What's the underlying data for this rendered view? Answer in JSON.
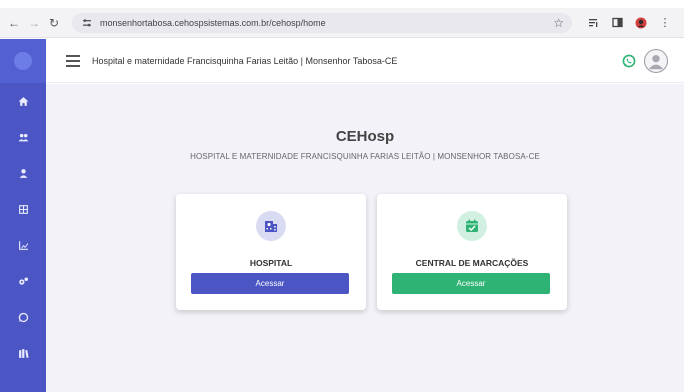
{
  "browser": {
    "url": "monsenhortabosa.cehospsistemas.com.br/cehosp/home"
  },
  "header": {
    "title": "Hospital e maternidade Francisquinha Farias Leitão | Monsenhor Tabosa-CE"
  },
  "sidebar": {
    "items": [
      {
        "icon": "home-icon"
      },
      {
        "icon": "users-icon"
      },
      {
        "icon": "user-icon"
      },
      {
        "icon": "grid-icon"
      },
      {
        "icon": "chart-icon"
      },
      {
        "icon": "cogs-icon"
      },
      {
        "icon": "whatsapp-icon"
      },
      {
        "icon": "library-icon"
      }
    ]
  },
  "main": {
    "title": "CEHosp",
    "subtitle": "HOSPITAL E MATERNIDADE FRANCISQUINHA FARIAS LEITÃO | MONSENHOR TABOSA-CE",
    "cards": [
      {
        "label": "HOSPITAL",
        "button": "Acessar",
        "icon": "hospital-icon",
        "color": "#4b56c4"
      },
      {
        "label": "CENTRAL DE MARCAÇÕES",
        "button": "Acessar",
        "icon": "calendar-check-icon",
        "color": "#2fb374"
      }
    ]
  },
  "colors": {
    "sidebar": "#4b56c4",
    "primary": "#4b56c4",
    "success": "#2fb374",
    "background": "#f2f2f8"
  }
}
